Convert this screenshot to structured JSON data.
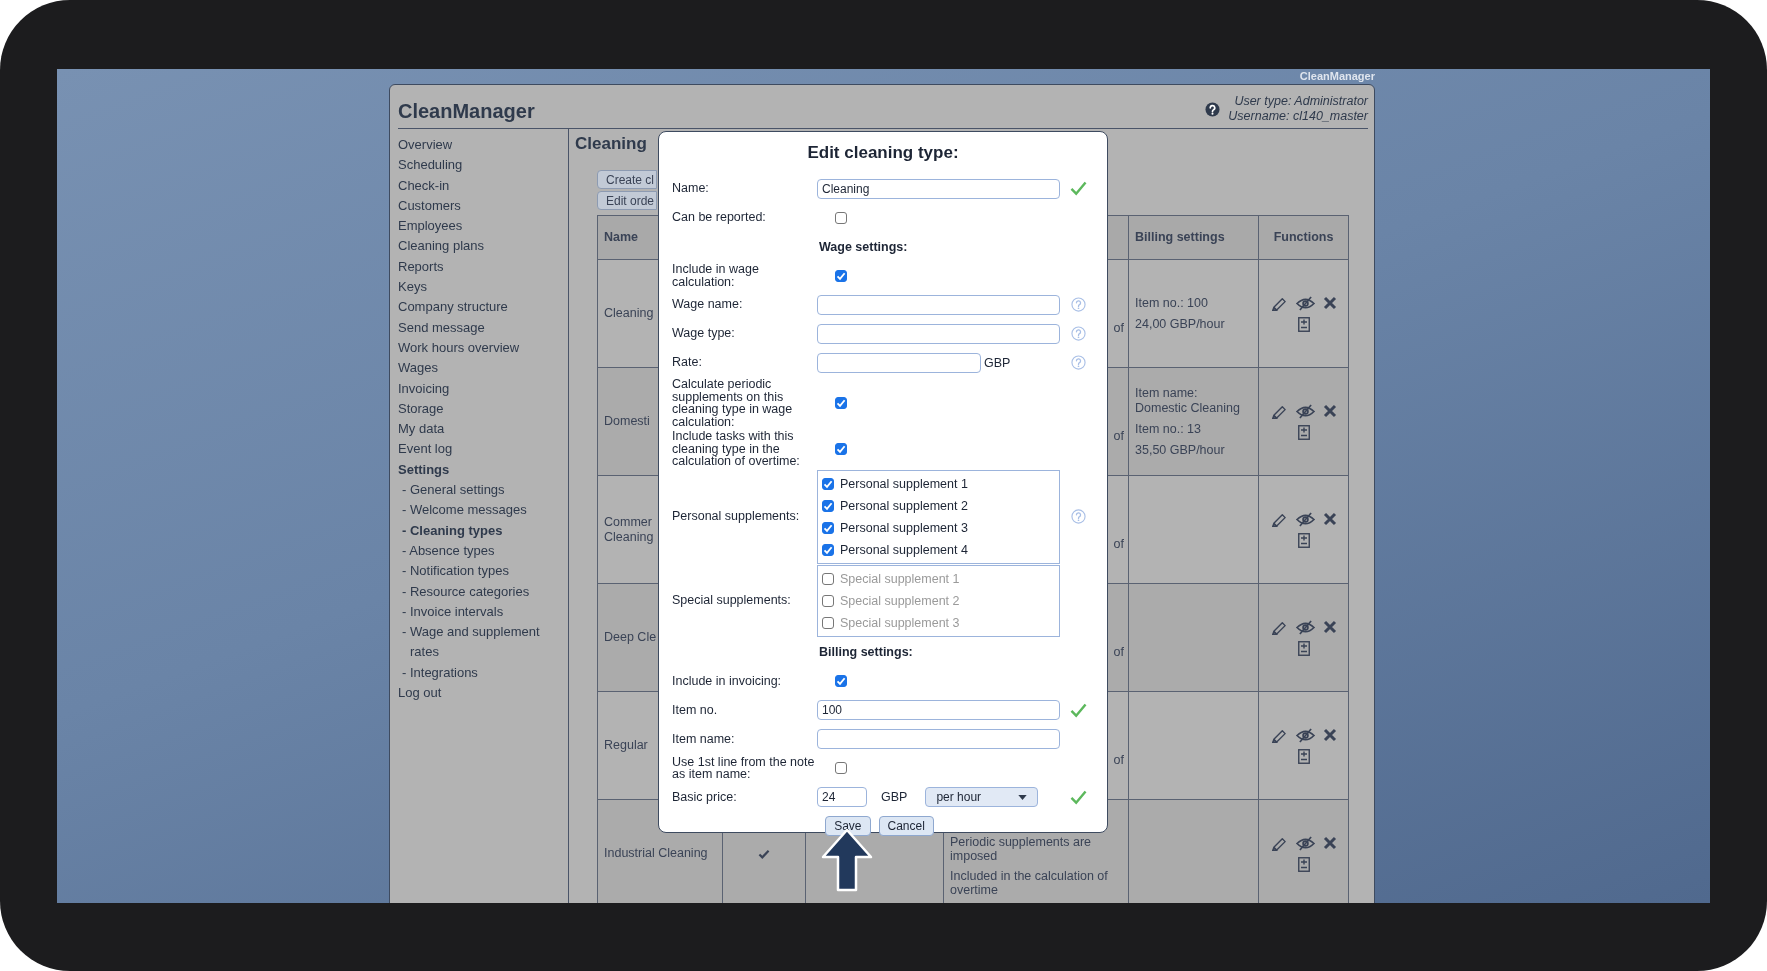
{
  "screen_label": "CleanManager",
  "app": {
    "title": "CleanManager",
    "user_type": "User type: Administrator",
    "username": "Username: cl140_master"
  },
  "sidebar": {
    "items": [
      {
        "label": "Overview",
        "selected": false
      },
      {
        "label": "Scheduling",
        "selected": false
      },
      {
        "label": "Check-in",
        "selected": false
      },
      {
        "label": "Customers",
        "selected": false
      },
      {
        "label": "Employees",
        "selected": false
      },
      {
        "label": "Cleaning plans",
        "selected": false
      },
      {
        "label": "Reports",
        "selected": false
      },
      {
        "label": "Keys",
        "selected": false
      },
      {
        "label": "Company structure",
        "selected": false
      },
      {
        "label": "Send message",
        "selected": false
      },
      {
        "label": "Work hours overview",
        "selected": false
      },
      {
        "label": "Wages",
        "selected": false
      },
      {
        "label": "Invoicing",
        "selected": false
      },
      {
        "label": "Storage",
        "selected": false
      },
      {
        "label": "My data",
        "selected": false
      },
      {
        "label": "Event log",
        "selected": false
      },
      {
        "label": "Settings",
        "selected": true,
        "children": [
          {
            "label": "- General settings",
            "selected": false
          },
          {
            "label": "- Welcome messages",
            "selected": false
          },
          {
            "label": "- Cleaning types",
            "selected": true
          },
          {
            "label": "- Absence types",
            "selected": false
          },
          {
            "label": "- Notification types",
            "selected": false
          },
          {
            "label": "- Resource categories",
            "selected": false
          },
          {
            "label": "- Invoice intervals",
            "selected": false
          },
          {
            "label": "- Wage and supplement rates",
            "selected": false
          },
          {
            "label": "- Integrations",
            "selected": false
          }
        ]
      },
      {
        "label": "Log out",
        "selected": false
      }
    ]
  },
  "page": {
    "title": "Cleaning",
    "buttons": [
      "Create cl",
      "Edit orde"
    ]
  },
  "table": {
    "columns": [
      {
        "kind": "name",
        "label": "Name"
      },
      {
        "kind": "billing",
        "label": "Billing settings"
      },
      {
        "kind": "functions",
        "label": "Functions"
      }
    ],
    "rows": [
      {
        "name_lines": [
          "Cleaning"
        ],
        "note_tail": "of",
        "billing": [
          "Item no.: 100",
          "24,00 GBP/hour"
        ]
      },
      {
        "name_lines": [
          "Domesti"
        ],
        "note_tail": "of",
        "billing": [
          "Item name: Domestic Cleaning",
          "Item no.: 13",
          "35,50 GBP/hour"
        ]
      },
      {
        "name_lines": [
          "Commer",
          "Cleaning"
        ],
        "note_tail": "of"
      },
      {
        "name_lines": [
          "Deep Cle"
        ],
        "note_tail": "of"
      },
      {
        "name_lines": [
          "Regular"
        ],
        "note_tail": "of"
      },
      {
        "name_lines": [
          "Industrial Cleaning"
        ],
        "checked": true,
        "notes": [
          "Periodic supplements are imposed",
          "Included in the calculation of overtime"
        ]
      }
    ]
  },
  "dialog": {
    "title": "Edit cleaning type:",
    "fields": [
      {
        "kind": "text",
        "label": "Name:",
        "value": "Cleaning",
        "valid": true
      },
      {
        "kind": "checkbox",
        "label": "Can be reported:",
        "checked": false
      },
      {
        "kind": "heading",
        "label": "Wage settings:"
      },
      {
        "kind": "checkbox",
        "label": "Include in wage calculation:",
        "checked": true
      },
      {
        "kind": "text",
        "label": "Wage name:",
        "help": true
      },
      {
        "kind": "text",
        "label": "Wage type:",
        "help": true
      },
      {
        "kind": "unit",
        "label": "Rate:",
        "unit": "GBP",
        "help": true
      },
      {
        "kind": "checkbox",
        "label": "Calculate periodic supplements on this cleaning type in wage calculation:",
        "checked": true
      },
      {
        "kind": "checkbox",
        "label": "Include tasks with this cleaning type in the calculation of overtime:",
        "checked": true
      },
      {
        "kind": "list",
        "label": "Personal supplements:",
        "help": true,
        "disabled": false,
        "options": [
          {
            "label": "Personal supplement 1",
            "checked": true
          },
          {
            "label": "Personal supplement 2",
            "checked": true
          },
          {
            "label": "Personal supplement 3",
            "checked": true
          },
          {
            "label": "Personal supplement 4",
            "checked": true
          }
        ]
      },
      {
        "kind": "list",
        "label": "Special supplements:",
        "disabled": true,
        "options": [
          {
            "label": "Special supplement 1",
            "checked": false
          },
          {
            "label": "Special supplement 2",
            "checked": false
          },
          {
            "label": "Special supplement 3",
            "checked": false
          }
        ]
      },
      {
        "kind": "heading",
        "label": "Billing settings:"
      },
      {
        "kind": "checkbox",
        "label": "Include in invoicing:",
        "checked": true
      },
      {
        "kind": "text",
        "label": "Item no.",
        "value": "100",
        "valid": true
      },
      {
        "kind": "text",
        "label": "Item name:"
      },
      {
        "kind": "checkbox",
        "label": "Use 1st line from the note as item name:",
        "checked": false
      },
      {
        "kind": "price",
        "label": "Basic price:",
        "value": "24",
        "unit": "GBP",
        "select": "per hour",
        "valid": true
      }
    ],
    "buttons": [
      "Save",
      "Cancel"
    ]
  }
}
